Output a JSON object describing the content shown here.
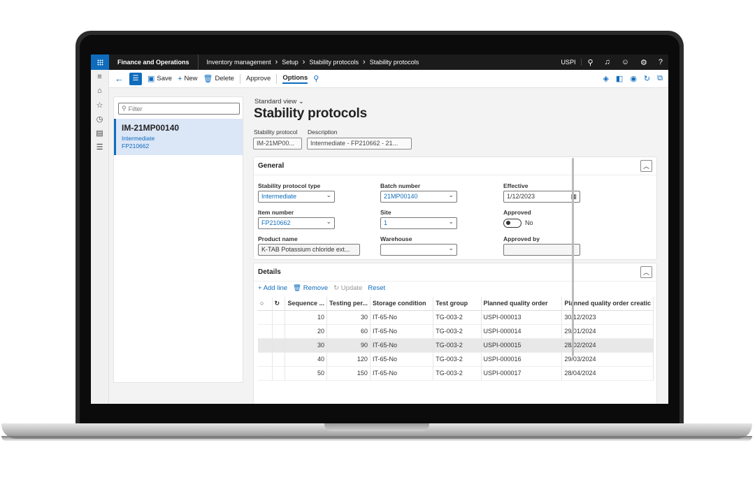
{
  "app": {
    "name": "Finance and Operations",
    "company": "USPI"
  },
  "breadcrumb": [
    "Inventory management",
    "Setup",
    "Stability protocols",
    "Stability protocols"
  ],
  "actions": {
    "save": "Save",
    "new": "New",
    "delete": "Delete",
    "approve": "Approve",
    "options": "Options"
  },
  "list": {
    "filter_placeholder": "Filter",
    "item_title": "IM-21MP00140",
    "item_type": "Intermediate",
    "item_number": "FP210662"
  },
  "header": {
    "view": "Standard view",
    "title": "Stability protocols",
    "protocol_label": "Stability protocol",
    "protocol_value": "IM-21MP00...",
    "description_label": "Description",
    "description_value": "Intermediate - FP210662 - 21..."
  },
  "general": {
    "title": "General",
    "protocol_type_label": "Stability protocol type",
    "protocol_type_value": "Intermediate",
    "batch_label": "Batch number",
    "batch_value": "21MP00140",
    "effective_label": "Effective",
    "effective_value": "1/12/2023",
    "item_label": "Item number",
    "item_value": "FP210662",
    "site_label": "Site",
    "site_value": "1",
    "approved_label": "Approved",
    "approved_value": "No",
    "product_label": "Product name",
    "product_value": "K-TAB Potassium chloride ext...",
    "warehouse_label": "Warehouse",
    "warehouse_value": "",
    "approved_by_label": "Approved by",
    "approved_by_value": ""
  },
  "details": {
    "title": "Details",
    "add_line": "Add line",
    "remove": "Remove",
    "update": "Update",
    "reset": "Reset",
    "columns": [
      "Sequence ...",
      "Testing per...",
      "Storage condition",
      "Test group",
      "Planned quality order",
      "Planned quality order creatic"
    ],
    "rows": [
      [
        "10",
        "30",
        "IT-65-No",
        "TG-003-2",
        "USPI-000013",
        "30/12/2023"
      ],
      [
        "20",
        "60",
        "IT-65-No",
        "TG-003-2",
        "USPI-000014",
        "29/01/2024"
      ],
      [
        "30",
        "90",
        "IT-65-No",
        "TG-003-2",
        "USPI-000015",
        "28/02/2024"
      ],
      [
        "40",
        "120",
        "IT-65-No",
        "TG-003-2",
        "USPI-000016",
        "29/03/2024"
      ],
      [
        "50",
        "150",
        "IT-65-No",
        "TG-003-2",
        "USPI-000017",
        "28/04/2024"
      ]
    ]
  }
}
